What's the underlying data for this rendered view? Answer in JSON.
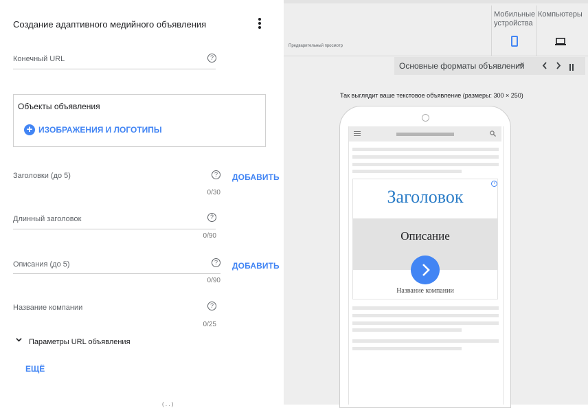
{
  "form": {
    "title": "Создание адаптивного медийного объявления",
    "final_url_label": "Конечный URL",
    "assets_title": "Объекты объявления",
    "assets_link": "ИЗОБРАЖЕНИЯ И ЛОГОТИПЫ",
    "headlines_label": "Заголовки (до 5)",
    "headlines_counter": "0/30",
    "long_headline_label": "Длинный заголовок",
    "long_headline_counter": "0/90",
    "descriptions_label": "Описания (до 5)",
    "descriptions_counter": "0/90",
    "company_label": "Название компании",
    "company_counter": "0/25",
    "add_label": "ДОБАВИТЬ",
    "url_params_label": "Параметры URL объявления",
    "more_label": "ЕЩЁ",
    "help_glyph": "?",
    "plus_glyph": "+",
    "cutoff_text": "(   .   .   )"
  },
  "preview": {
    "preview_label": "Предварительный просмотр",
    "mobile_label": "Мобильные устройства",
    "desktop_label": "Компьютеры",
    "formats_label": "Основные форматы объявлений",
    "prev_glyph": "‹",
    "next_glyph": "›",
    "caption": "Так выглядит ваше текстовое объявление (размеры: 300 × 250)",
    "ad_headline": "Заголовок",
    "ad_description": "Описание",
    "ad_company": "Название компании",
    "info_glyph": "i"
  },
  "colors": {
    "accent": "#4285f4",
    "headline": "#2a7cc7",
    "panel_bg": "#eeeeee"
  },
  "icons": [
    "more-vert-icon",
    "help-icon",
    "add-circle-icon",
    "expand-icon",
    "smartphone-icon",
    "laptop-icon",
    "dropdown-icon",
    "chevron-left-icon",
    "chevron-right-icon",
    "pause-icon",
    "menu-icon",
    "search-icon",
    "info-icon",
    "arrow-forward-icon"
  ]
}
